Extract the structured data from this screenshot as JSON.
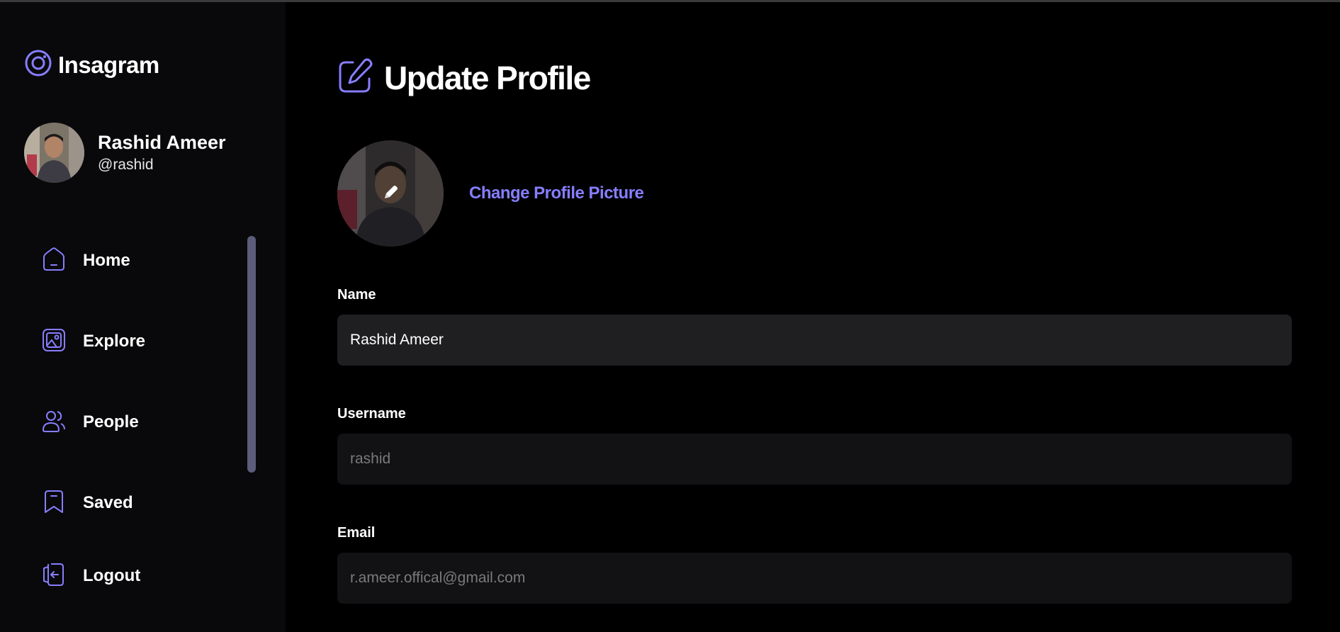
{
  "app": {
    "name": "Insagram"
  },
  "user": {
    "name": "Rashid Ameer",
    "handle": "@rashid"
  },
  "nav": {
    "items": [
      {
        "label": "Home",
        "icon": "home-icon"
      },
      {
        "label": "Explore",
        "icon": "gallery-icon"
      },
      {
        "label": "People",
        "icon": "people-icon"
      },
      {
        "label": "Saved",
        "icon": "bookmark-icon"
      },
      {
        "label": "Logout",
        "icon": "logout-icon"
      }
    ]
  },
  "page": {
    "title": "Update Profile",
    "change_picture_label": "Change Profile Picture"
  },
  "form": {
    "name": {
      "label": "Name",
      "value": "Rashid Ameer"
    },
    "username": {
      "label": "Username",
      "value": "rashid"
    },
    "email": {
      "label": "Email",
      "value": "r.ameer.offical@gmail.com"
    }
  },
  "colors": {
    "accent": "#877eff",
    "sidebar_bg": "#09090b",
    "input_bg": "#1f1f22",
    "input_disabled_bg": "#121214"
  }
}
